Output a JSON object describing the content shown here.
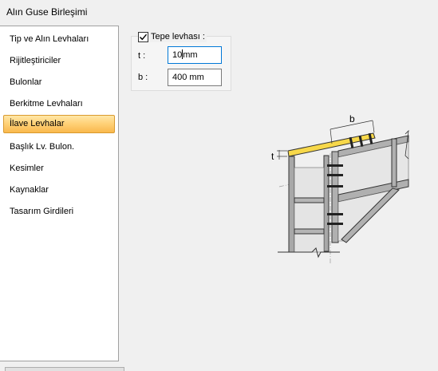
{
  "window": {
    "title": "Alın Guse Birleşimi"
  },
  "sidebar": {
    "items": [
      {
        "label": "Tip ve Alın Levhaları"
      },
      {
        "label": "Rijitleştiriciler"
      },
      {
        "label": "Bulonlar"
      },
      {
        "label": "Berkitme Levhaları"
      },
      {
        "label": "İlave Levhalar",
        "selected": true
      },
      {
        "label": "Başlık Lv. Bulon."
      },
      {
        "label": "Kesimler"
      },
      {
        "label": "Kaynaklar"
      },
      {
        "label": "Tasarım Girdileri"
      }
    ]
  },
  "top_plate": {
    "checkbox_label": "Tepe levhası :",
    "checked": true,
    "t_label": "t :",
    "t_value_before_caret": "10",
    "t_value_after_caret": "mm",
    "b_label": "b :",
    "b_value": "400 mm"
  },
  "diagram": {
    "dimension_b": "b",
    "dimension_t": "t"
  },
  "colors": {
    "selection_top": "#ffe7a8",
    "selection_bottom": "#f9b84d",
    "plate_yellow": "#f7d84a",
    "steel_grey": "#9a9a9a"
  }
}
